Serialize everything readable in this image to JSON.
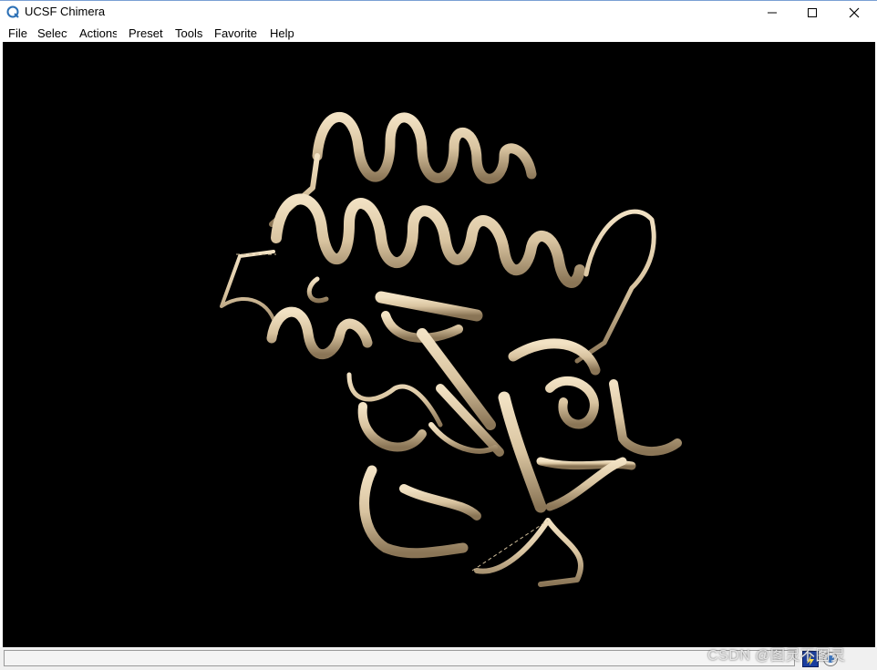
{
  "window": {
    "title": "UCSF Chimera",
    "icon": "chimera-logo-icon"
  },
  "controls": {
    "minimize_icon": "minimize-icon",
    "maximize_icon": "maximize-icon",
    "close_icon": "close-icon"
  },
  "menu": [
    {
      "label": "File"
    },
    {
      "label": "Select"
    },
    {
      "label": "Actions"
    },
    {
      "label": "Preset"
    },
    {
      "label": "Tools"
    },
    {
      "label": "Favorite"
    },
    {
      "label": "Help"
    }
  ],
  "viewer": {
    "background_color": "#000000",
    "ribbon_color": "#d9c4a0",
    "content": "protein-ribbon-model"
  },
  "statusbar": {
    "message": "",
    "icons": [
      "command-line-icon",
      "stop-icon"
    ]
  },
  "watermark": "CSDN @图灵不图灵"
}
